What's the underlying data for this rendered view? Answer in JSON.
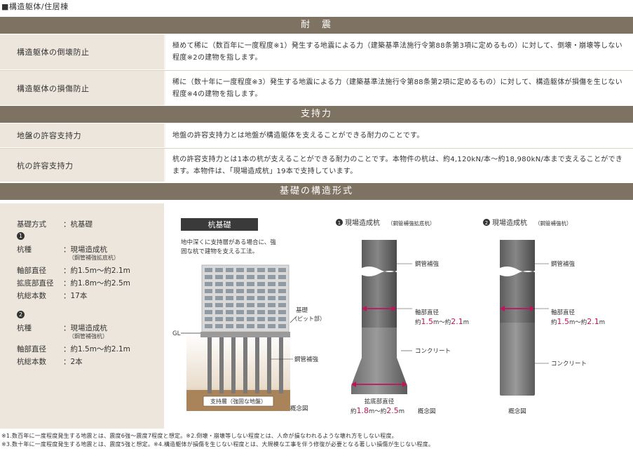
{
  "page_title": "■構造躯体/住居棟",
  "sections": {
    "seismic": {
      "heading": "耐　震",
      "rows": [
        {
          "label": "構造躯体の倒壊防止",
          "description": "極めて稀に（数百年に一度程度※1）発生する地震による力（建築基準法施行令第88条第3項に定めるもの）に対して、倒壊・崩壊等しない程度※2の建物を指します。"
        },
        {
          "label": "構造躯体の損傷防止",
          "description": "稀に（数十年に一度程度※3）発生する地震による力（建築基準法施行令第88条第2項に定めるもの）に対して、構造躯体が損傷を生じない程度※4の建物を指します。"
        }
      ]
    },
    "bearing": {
      "heading": "支持力",
      "rows": [
        {
          "label": "地盤の許容支持力",
          "description": "地盤の許容支持力とは地盤が構造躯体を支えることができる耐力のことです。"
        },
        {
          "label": "杭の許容支持力",
          "description": "杭の許容支持力とは1本の杭が支えることができる耐力のことです。本物件の杭は、約4,120kN/本〜約18,980kN/本まで支えることができます。本物件は、「現場造成杭」19本で支持しています。"
        }
      ]
    },
    "foundation": {
      "heading": "基礎の構造形式",
      "specs": {
        "method_key": "基礎方式",
        "method_val": "：杭基礎",
        "group1_num": "1",
        "group1": [
          {
            "key": "杭種",
            "val": "：現場造成杭"
          },
          {
            "key": "軸部直径",
            "val": "：約1.5m〜約2.1m"
          },
          {
            "key": "拡底部直径",
            "val": "：約1.8m〜約2.5m"
          },
          {
            "key": "杭総本数",
            "val": "：17本"
          }
        ],
        "group1_sub": "（鋼管補強拡底杭）",
        "group2_num": "2",
        "group2": [
          {
            "key": "杭種",
            "val": "：現場造成杭"
          },
          {
            "key": "軸部直径",
            "val": "：約1.5m〜約2.1m"
          },
          {
            "key": "杭総本数",
            "val": "：2本"
          }
        ],
        "group2_sub": "（鋼管補強杭）"
      },
      "diagram": {
        "pile_foundation_title": "杭基礎",
        "pile_foundation_desc1": "地中深くに支持層がある場合に、強",
        "pile_foundation_desc2": "固な杭で建物を支える工法。",
        "gl": "GL",
        "kiso": "基礎",
        "kiso_sub": "（ピット部）",
        "steel": "鋼管補強",
        "bearing_layer": "支持層（強固な地盤）",
        "concept": "概念図",
        "pile1_title": "現場造成杭",
        "pile1_sub": "（鋼管補強拡底杭）",
        "pile1_num": "1",
        "pile2_title": "現場造成杭",
        "pile2_sub": "（鋼管補強杭）",
        "pile2_num": "2",
        "shaft_dia": "軸部直径",
        "shaft_dia_val_pre": "約",
        "shaft_dia_min": "1.5",
        "shaft_dia_mid": "m〜約",
        "shaft_dia_max": "2.1",
        "shaft_dia_unit": "m",
        "concrete": "コンクリート",
        "base_dia": "拡底部直径",
        "base_dia_val_pre": "約",
        "base_dia_min": "1.8",
        "base_dia_mid": "m〜約",
        "base_dia_max": "2.5",
        "base_dia_unit": "m"
      },
      "colors": {
        "accent": "#c0145a",
        "header": "#7e7262"
      }
    }
  },
  "notes": [
    "※1.数百年に一度程度発生する地震とは、震度6強〜震度7程度と想定。※2.倒壊・崩壊等しない程度とは、人命が損なわれるような壊れ方をしない程度。",
    "※3.数十年に一度程度発生する地震とは、震度5強と想定。※4.構造躯体が損傷を生じない程度とは、大規模な工事を伴う修復が必要となる著しい損傷が生じない程度。"
  ]
}
